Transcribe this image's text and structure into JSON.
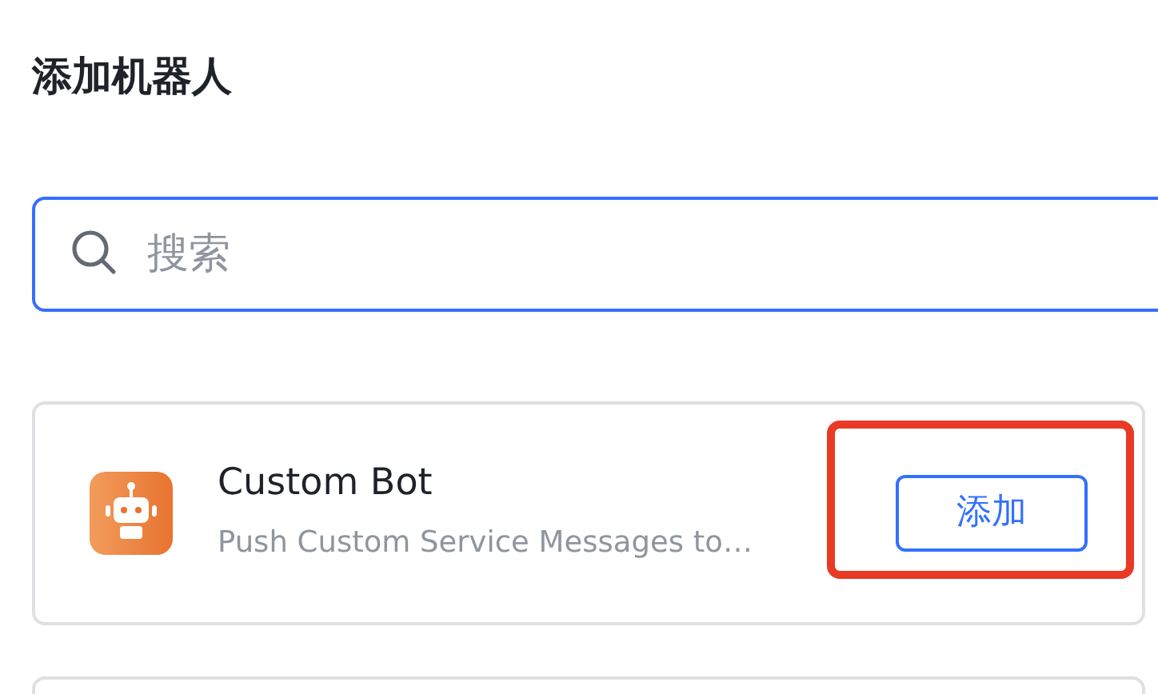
{
  "title": "添加机器人",
  "search": {
    "placeholder": "搜索"
  },
  "bots": [
    {
      "name": "Custom Bot",
      "description": "Push Custom Service Messages to…",
      "button": "添加",
      "highlighted": true
    }
  ]
}
